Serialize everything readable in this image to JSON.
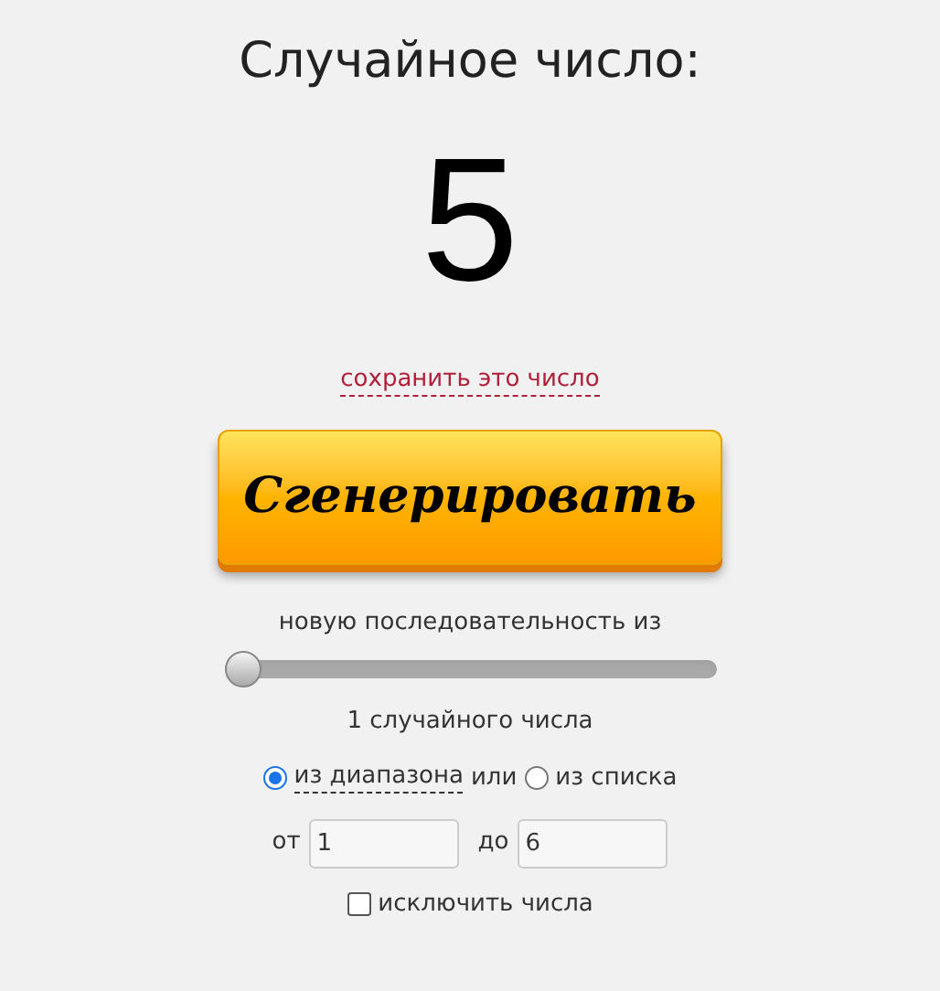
{
  "title": "Случайное число:",
  "result": "5",
  "save_link": "сохранить это число",
  "generate_button": "Сгенерировать",
  "sequence_label": "новую последовательность из",
  "count_slider": {
    "level": 0
  },
  "count_label": "1 случайного числа",
  "source": {
    "options": [
      {
        "label": "из диапазона",
        "selected": true
      },
      {
        "label": "из списка",
        "selected": false
      }
    ],
    "joiner": "или"
  },
  "range": {
    "from_label": "от",
    "from_value": "1",
    "to_label": "до",
    "to_value": "6"
  },
  "exclude": {
    "label": "исключить числа",
    "checked": false
  }
}
